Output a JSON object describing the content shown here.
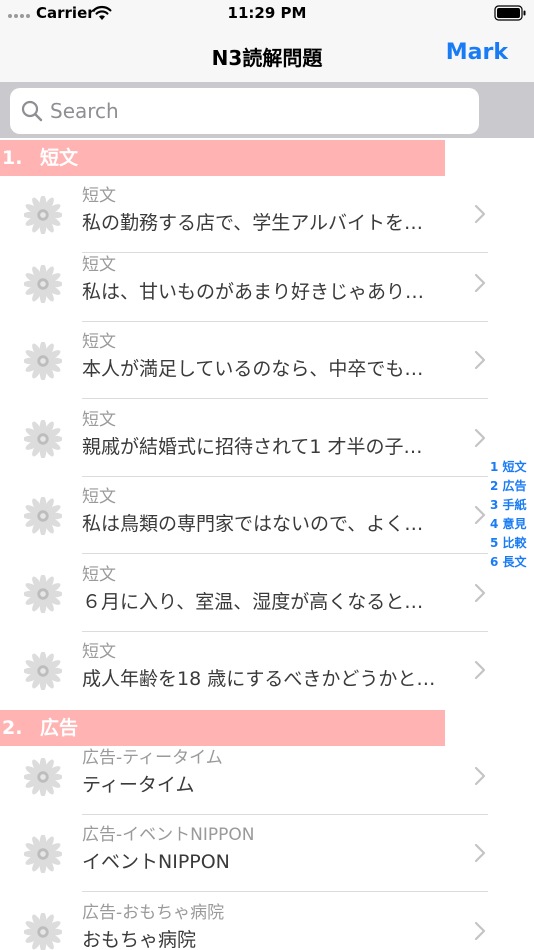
{
  "status_bar": {
    "carrier": "Carrier",
    "time": "11:29 PM"
  },
  "nav": {
    "title": "N3読解問題",
    "mark_label": "Mark"
  },
  "search": {
    "placeholder": "Search"
  },
  "sections": [
    {
      "index": "1.",
      "title": "短文"
    },
    {
      "index": "2.",
      "title": "広告"
    }
  ],
  "rows": [
    {
      "subtitle": "短文",
      "title": "私の勤務する店で、学生アルバイトを…"
    },
    {
      "subtitle": "短文",
      "title": "私は、甘いものがあまり好きじゃあり…"
    },
    {
      "subtitle": "短文",
      "title": "本人が満足しているのなら、中卒でも…"
    },
    {
      "subtitle": "短文",
      "title": "親戚が結婚式に招待されて1 才半の子…"
    },
    {
      "subtitle": "短文",
      "title": "私は鳥類の専門家ではないので、よく…"
    },
    {
      "subtitle": "短文",
      "title": "６月に入り、室温、湿度が高くなると…"
    },
    {
      "subtitle": "短文",
      "title": "成人年齢を18 歳にするべきかどうかと…"
    },
    {
      "subtitle": "広告-ティータイム",
      "title": "ティータイム"
    },
    {
      "subtitle": "広告-イベントNIPPON",
      "title": "イベントNIPPON"
    },
    {
      "subtitle": "広告-おもちゃ病院",
      "title": "おもちゃ病院"
    }
  ],
  "index_bar": [
    "1 短文",
    "2 広告",
    "3 手紙",
    "4 意見",
    "5 比較",
    "6 長文"
  ],
  "colors": {
    "accent": "#1a7cf5",
    "section_header_bg": "#ffb3b3",
    "search_bar_bg": "#c9c9ce"
  },
  "icons": {
    "row_avatar": "flower-icon",
    "row_accessory": "chevron-right-icon",
    "search": "search-icon"
  }
}
